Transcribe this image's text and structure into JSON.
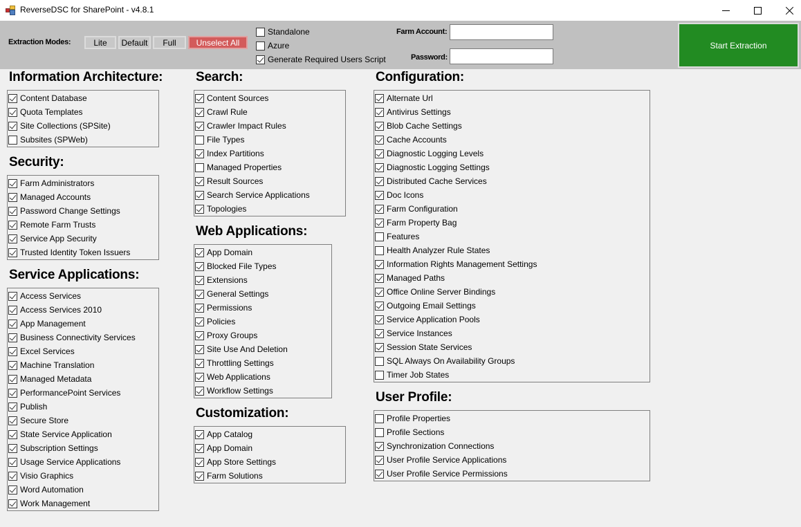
{
  "window": {
    "title": "ReverseDSC for SharePoint - v4.8.1",
    "controls": {
      "minimize": "minimize",
      "maximize": "maximize",
      "close": "close"
    }
  },
  "toolbar": {
    "modes_label": "Extraction Modes:",
    "modes": {
      "lite": "Lite",
      "default": "Default",
      "full": "Full",
      "unselect_all": "Unselect All"
    },
    "options": [
      {
        "label": "Standalone",
        "checked": false
      },
      {
        "label": "Azure",
        "checked": false
      },
      {
        "label": "Generate Required Users Script",
        "checked": true
      }
    ],
    "farm_account_label": "Farm Account:",
    "farm_account_value": "",
    "password_label": "Password:",
    "password_value": "",
    "start_label": "Start Extraction"
  },
  "colors": {
    "unselect_all": "#d35b5b",
    "start_extraction": "#228b22",
    "toolbar_bg": "#c0c0c0"
  },
  "sections": {
    "info_arch": {
      "title": "Information Architecture:",
      "items": [
        {
          "label": "Content Database",
          "checked": true
        },
        {
          "label": "Quota Templates",
          "checked": true
        },
        {
          "label": "Site Collections (SPSite)",
          "checked": true
        },
        {
          "label": "Subsites (SPWeb)",
          "checked": false
        }
      ]
    },
    "security": {
      "title": "Security:",
      "items": [
        {
          "label": "Farm Administrators",
          "checked": true
        },
        {
          "label": "Managed Accounts",
          "checked": true
        },
        {
          "label": "Password Change Settings",
          "checked": true
        },
        {
          "label": "Remote Farm Trusts",
          "checked": true
        },
        {
          "label": "Service App Security",
          "checked": true
        },
        {
          "label": "Trusted Identity Token Issuers",
          "checked": true
        }
      ]
    },
    "service_apps": {
      "title": "Service Applications:",
      "items": [
        {
          "label": "Access Services",
          "checked": true
        },
        {
          "label": "Access Services 2010",
          "checked": true
        },
        {
          "label": "App Management",
          "checked": true
        },
        {
          "label": "Business Connectivity Services",
          "checked": true
        },
        {
          "label": "Excel Services",
          "checked": true
        },
        {
          "label": "Machine Translation",
          "checked": true
        },
        {
          "label": "Managed Metadata",
          "checked": true
        },
        {
          "label": "PerformancePoint Services",
          "checked": true
        },
        {
          "label": "Publish",
          "checked": true
        },
        {
          "label": "Secure Store",
          "checked": true
        },
        {
          "label": "State Service Application",
          "checked": true
        },
        {
          "label": "Subscription Settings",
          "checked": true
        },
        {
          "label": "Usage Service Applications",
          "checked": true
        },
        {
          "label": "Visio Graphics",
          "checked": true
        },
        {
          "label": "Word Automation",
          "checked": true
        },
        {
          "label": "Work Management",
          "checked": true
        }
      ]
    },
    "search": {
      "title": "Search:",
      "items": [
        {
          "label": "Content Sources",
          "checked": true
        },
        {
          "label": "Crawl Rule",
          "checked": true
        },
        {
          "label": "Crawler Impact Rules",
          "checked": true
        },
        {
          "label": "File Types",
          "checked": false
        },
        {
          "label": "Index Partitions",
          "checked": true
        },
        {
          "label": "Managed Properties",
          "checked": false
        },
        {
          "label": "Result Sources",
          "checked": true
        },
        {
          "label": "Search Service Applications",
          "checked": true
        },
        {
          "label": "Topologies",
          "checked": true
        }
      ]
    },
    "web_apps": {
      "title": "Web Applications:",
      "items": [
        {
          "label": "App Domain",
          "checked": true
        },
        {
          "label": "Blocked File Types",
          "checked": true
        },
        {
          "label": "Extensions",
          "checked": true
        },
        {
          "label": "General Settings",
          "checked": true
        },
        {
          "label": "Permissions",
          "checked": true
        },
        {
          "label": "Policies",
          "checked": true
        },
        {
          "label": "Proxy Groups",
          "checked": true
        },
        {
          "label": "Site Use And Deletion",
          "checked": true
        },
        {
          "label": "Throttling Settings",
          "checked": true
        },
        {
          "label": "Web Applications",
          "checked": true
        },
        {
          "label": "Workflow Settings",
          "checked": true
        }
      ]
    },
    "customization": {
      "title": "Customization:",
      "items": [
        {
          "label": "App Catalog",
          "checked": true
        },
        {
          "label": "App Domain",
          "checked": true
        },
        {
          "label": "App Store Settings",
          "checked": true
        },
        {
          "label": "Farm Solutions",
          "checked": true
        }
      ]
    },
    "configuration": {
      "title": "Configuration:",
      "items": [
        {
          "label": "Alternate Url",
          "checked": true
        },
        {
          "label": "Antivirus Settings",
          "checked": true
        },
        {
          "label": "Blob Cache Settings",
          "checked": true
        },
        {
          "label": "Cache Accounts",
          "checked": true
        },
        {
          "label": "Diagnostic Logging Levels",
          "checked": true
        },
        {
          "label": "Diagnostic Logging Settings",
          "checked": true
        },
        {
          "label": "Distributed Cache Services",
          "checked": true
        },
        {
          "label": "Doc Icons",
          "checked": true
        },
        {
          "label": "Farm Configuration",
          "checked": true
        },
        {
          "label": "Farm Property Bag",
          "checked": true
        },
        {
          "label": "Features",
          "checked": false
        },
        {
          "label": "Health Analyzer Rule States",
          "checked": false
        },
        {
          "label": "Information Rights Management Settings",
          "checked": true
        },
        {
          "label": "Managed Paths",
          "checked": true
        },
        {
          "label": "Office Online Server Bindings",
          "checked": true
        },
        {
          "label": "Outgoing Email Settings",
          "checked": true
        },
        {
          "label": "Service Application Pools",
          "checked": true
        },
        {
          "label": "Service Instances",
          "checked": true
        },
        {
          "label": "Session State Services",
          "checked": true
        },
        {
          "label": "SQL Always On Availability Groups",
          "checked": false
        },
        {
          "label": "Timer Job States",
          "checked": false
        }
      ]
    },
    "user_profile": {
      "title": "User Profile:",
      "items": [
        {
          "label": "Profile Properties",
          "checked": false
        },
        {
          "label": "Profile Sections",
          "checked": false
        },
        {
          "label": "Synchronization Connections",
          "checked": true
        },
        {
          "label": "User Profile Service Applications",
          "checked": true
        },
        {
          "label": "User Profile Service Permissions",
          "checked": true
        }
      ]
    }
  }
}
